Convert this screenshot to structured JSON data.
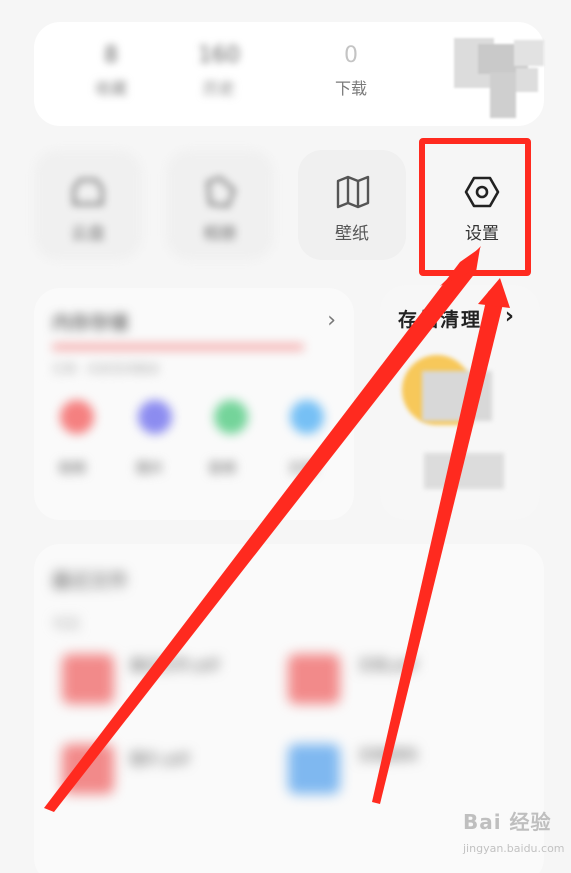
{
  "stats": [
    {
      "num": "8",
      "label": "收藏"
    },
    {
      "num": "160",
      "label": "历史"
    },
    {
      "num": "0",
      "label": "下载"
    }
  ],
  "tools": [
    {
      "label": "云盘",
      "icon": "cloud-icon"
    },
    {
      "label": "相册",
      "icon": "photo-icon"
    },
    {
      "label": "壁纸",
      "icon": "wallpaper-icon"
    },
    {
      "label": "设置",
      "icon": "settings-hexagon-icon"
    }
  ],
  "storage": {
    "title": "内存存储",
    "chevron": "›",
    "sub": "已用 · 内存空间剩余",
    "apps": [
      {
        "label": "视频",
        "color": "#f58080"
      },
      {
        "label": "图片",
        "color": "#8c8cf0"
      },
      {
        "label": "音频",
        "color": "#74d49a"
      },
      {
        "label": "文档",
        "color": "#76c0f5"
      }
    ]
  },
  "junk": {
    "title": "存储清理",
    "chevron": "›"
  },
  "recent": {
    "title": "最近文件",
    "section": "今天",
    "files": [
      {
        "name": "最近文件.pdf",
        "color": "#f28a8a"
      },
      {
        "name": "文档.pdf",
        "color": "#f28a8a"
      },
      {
        "name": "图片.pdf",
        "color": "#f28a8a"
      },
      {
        "name": "文档资料",
        "color": "#7fb8f0"
      }
    ]
  },
  "watermark": {
    "text": "Bai 经验",
    "url": "jingyan.baidu.com"
  },
  "colors": {
    "highlight": "#ff2a1f",
    "arrow": "#ff2a1f"
  }
}
